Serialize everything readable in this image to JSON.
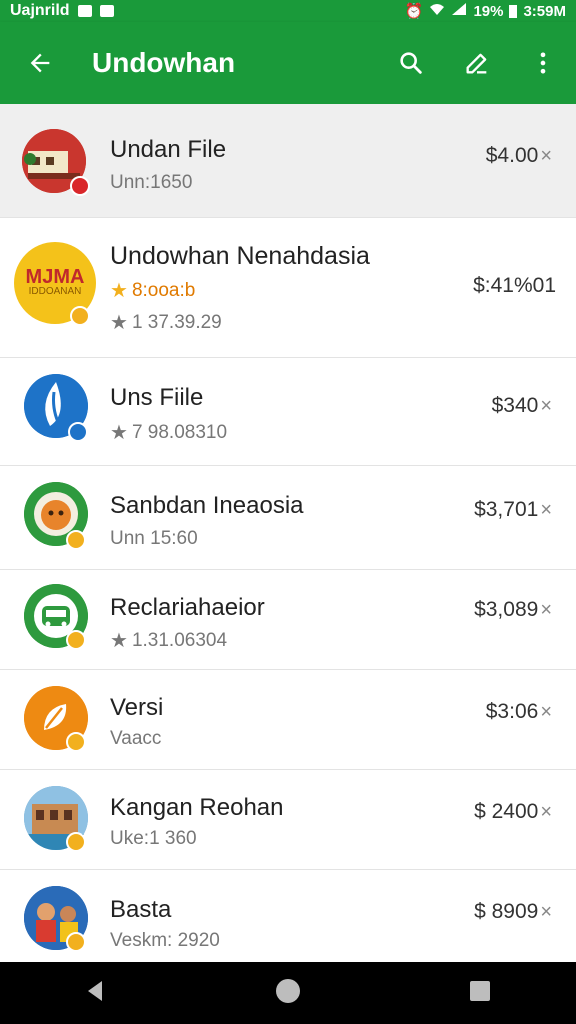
{
  "status_bar": {
    "carrier": "Uajnrild",
    "battery": "19%",
    "time": "3:59M"
  },
  "app_bar": {
    "title": "Undowhan",
    "back_icon": "arrow-left-icon",
    "search_icon": "search-icon",
    "edit_icon": "edit-icon",
    "more_icon": "more-vert-icon"
  },
  "items": [
    {
      "name": "Undan File",
      "sub": "Unn:1650",
      "price": "$4.00",
      "sub_style": "plain"
    },
    {
      "name": "Undowhan Nenahdasia",
      "rating_label": "8:ooa:b",
      "sub": "1 37.39.29",
      "price": "$:41%01",
      "sub_style": "star"
    },
    {
      "name": "Uns Fiile",
      "sub": "7 98.08310",
      "price": "$340",
      "sub_style": "star"
    },
    {
      "name": "Sanbdan Ineaosia",
      "sub": "Unn 15:60",
      "price": "$3,701",
      "sub_style": "plain"
    },
    {
      "name": "Reclariahaeior",
      "sub": "1.31.06304",
      "price": "$3,089",
      "sub_style": "star"
    },
    {
      "name": "Versi",
      "sub": "Vaacc",
      "price": "$3:06",
      "sub_style": "plain"
    },
    {
      "name": "Kangan Reohan",
      "sub": "Uke:1 360",
      "price": "$ 2400",
      "sub_style": "plain"
    },
    {
      "name": "Basta",
      "sub": "Veskm: 2920",
      "price": "$ 8909",
      "sub_style": "plain"
    }
  ],
  "avatar_logo_text": [
    "MJMA",
    "IDDOANAN"
  ],
  "remove_glyph": "×",
  "colors": {
    "primary": "#1a9a3a",
    "badge_yellow": "#f2b01e",
    "badge_red": "#d9262a",
    "badge_blue": "#1e73c8"
  }
}
